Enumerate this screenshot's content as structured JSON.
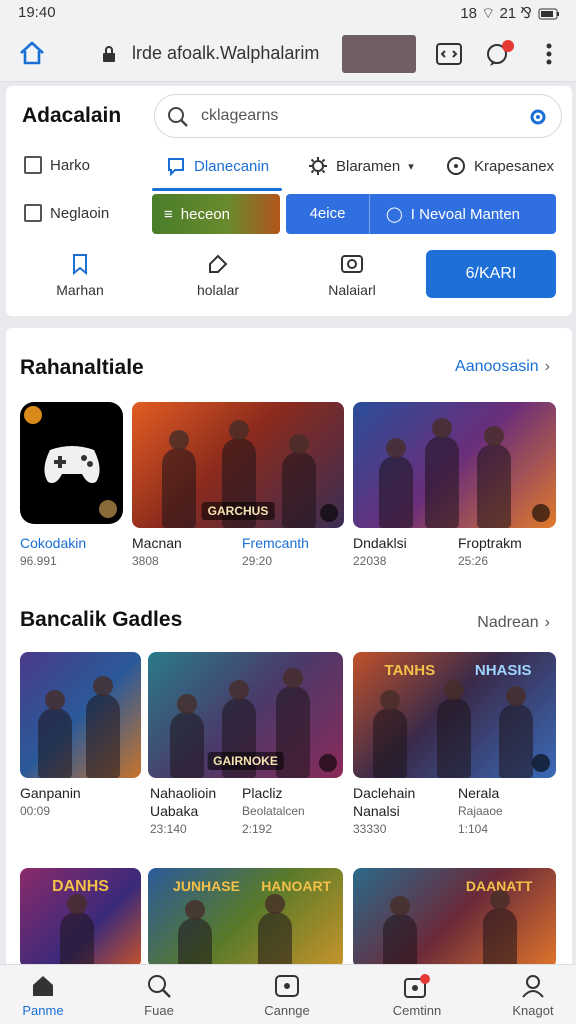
{
  "status": {
    "time": "19:40",
    "icons": "18 ⌔ 21 ⅋"
  },
  "browser": {
    "url": "lrde afoalk.Walphalarim"
  },
  "header": {
    "brand": "Adacalain",
    "search_value": "cklagearns"
  },
  "filters": {
    "check1": "Harko",
    "check2": "Neglaoin",
    "tab_active": "Dlanecanin",
    "tab2": "Blaramen",
    "tab3": "Krapesanex",
    "pill_green": "heceon",
    "pill_blue_left": "4eice",
    "pill_blue_right": "I Nevoal Manten"
  },
  "quick_actions": {
    "q1": "Marhan",
    "q2": "holalar",
    "q3": "Nalaiarl",
    "cta": "6/KARI"
  },
  "section1": {
    "title": "Rahanaltiale",
    "link": "Aanoosasin",
    "items": [
      {
        "name": "Cokodakin",
        "meta": "96.991",
        "accent": true
      },
      {
        "name": "Macnan",
        "meta": "3808",
        "accent": false
      },
      {
        "name": "Fremcanth",
        "meta": "29:20",
        "accent": true
      },
      {
        "name": "Dndaklsi",
        "meta": "22038",
        "accent": false
      },
      {
        "name": "Froptrakm",
        "meta": "25:26",
        "accent": false
      }
    ],
    "tile_label": "GARCHUS"
  },
  "section2": {
    "title": "Bancalik Gadles",
    "link": "Nadrean",
    "items": [
      {
        "name": "Ganpanin",
        "meta": "00:09"
      },
      {
        "name": "Nahaolioin",
        "sub": "Uabaka",
        "meta": "23:140"
      },
      {
        "name": "Placliz",
        "sub": "Beolatalcen",
        "meta": "2:192"
      },
      {
        "name": "Daclehain",
        "sub": "Nanalsi",
        "meta": "33330"
      },
      {
        "name": "Nerala",
        "sub": "Rajaaoe",
        "meta": "1:104"
      }
    ],
    "tile_label": "GAIRNOKE",
    "banner1": "TANHS",
    "banner2": "NHASIS"
  },
  "section3": {
    "banner1": "DANHS",
    "banner2": "JUNHASE",
    "banner3": "HANOART",
    "banner4": "DAANATT"
  },
  "nav": {
    "n1": "Panme",
    "n2": "Fuae",
    "n3": "Cannge",
    "n4": "Cemtinn",
    "n5": "Knagot"
  },
  "colors": {
    "accent": "#1a6fd6",
    "cta": "#1f6fd9",
    "green": "#4a7d2a"
  }
}
